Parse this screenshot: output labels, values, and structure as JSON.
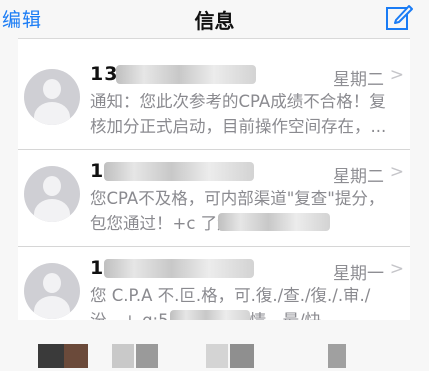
{
  "header": {
    "edit_label": "编辑",
    "title": "信息",
    "compose_icon": "compose-icon",
    "accent": "#1a7cf5"
  },
  "messages": [
    {
      "sender": "13",
      "date": "星期二",
      "preview_line1": "通知：您此次参考的CPA成绩不合格！复",
      "preview_line2": "核加分正式启动，目前操作空间存在，..."
    },
    {
      "sender": "1",
      "date": "星期二",
      "preview_line1": "您CPA不及格，可内部渠道\"复查\"提分，",
      "preview_line2": "包您通过！+c                    了解详情。..."
    },
    {
      "sender": "1",
      "date": "星期一",
      "preview_line1": "您 C.P.A 不.叵.格，可.復./查./復./.审./",
      "preview_line2": "汾，+.q:55          了.解.詳.情。最/快..."
    }
  ],
  "colors": {
    "secondary_text": "#8a8a8f",
    "date_text": "#8e8e93"
  }
}
